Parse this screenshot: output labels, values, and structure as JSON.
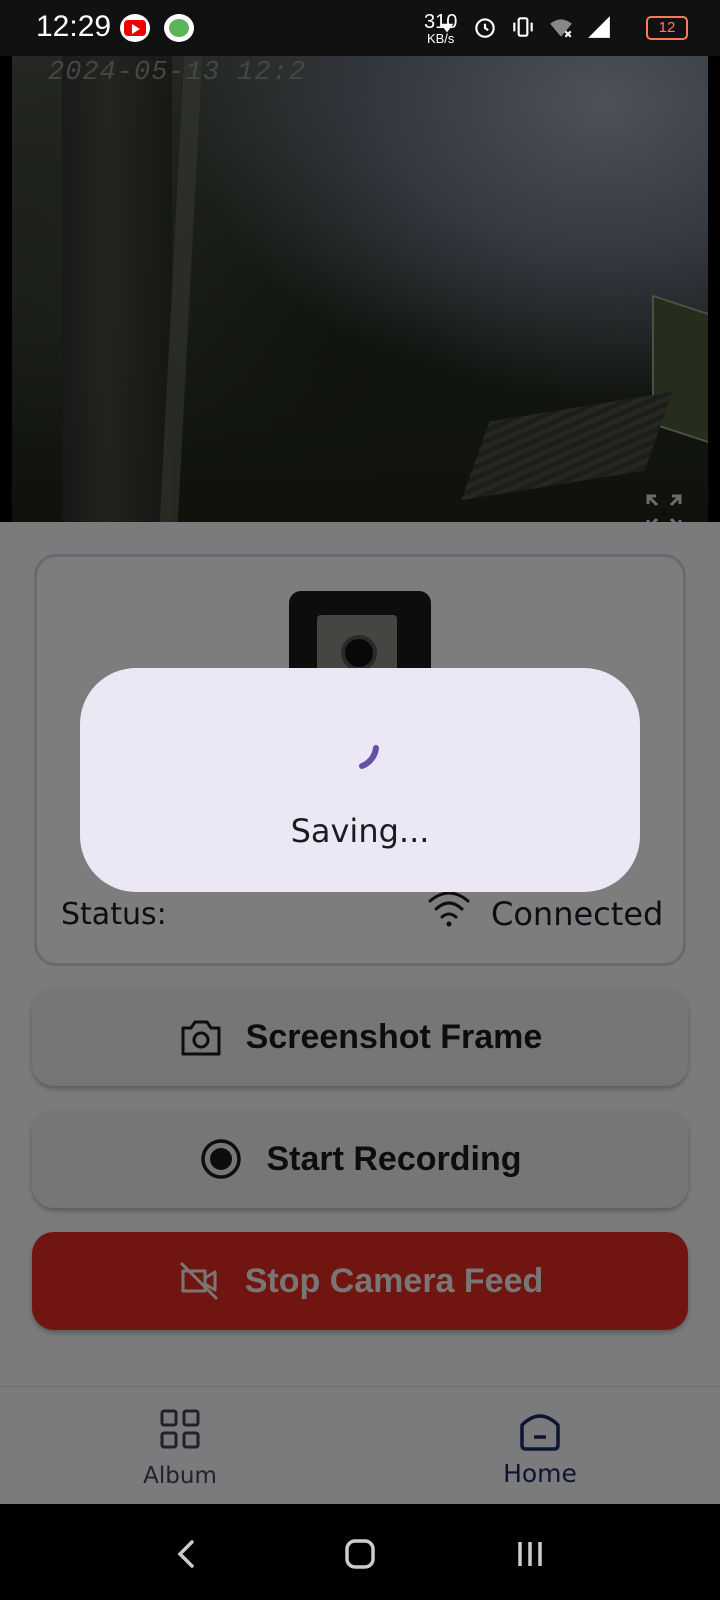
{
  "status_bar": {
    "time": "12:29",
    "net_speed_value": "310",
    "net_speed_unit": "KB/s",
    "battery": "12",
    "icons": [
      "youtube-icon",
      "app-icon",
      "alarm-icon",
      "vibrate-icon",
      "wifi-off-icon",
      "signal-icon"
    ]
  },
  "camera_feed": {
    "timestamp": "2024-05-13 12:2"
  },
  "device_card": {
    "status_label": "Status:",
    "status_value": "Connected"
  },
  "actions": {
    "screenshot": "Screenshot Frame",
    "record": "Start Recording",
    "stop": "Stop Camera Feed"
  },
  "bottom_nav": {
    "items": [
      {
        "label": "Album",
        "icon": "grid-icon",
        "active": false
      },
      {
        "label": "Home",
        "icon": "home-icon",
        "active": true
      }
    ]
  },
  "dialog": {
    "message": "Saving..."
  },
  "colors": {
    "accent": "#6750a4",
    "stop_button": "#e02b20",
    "nav_active": "#1d2a63",
    "dialog_bg": "#ece7f4"
  }
}
